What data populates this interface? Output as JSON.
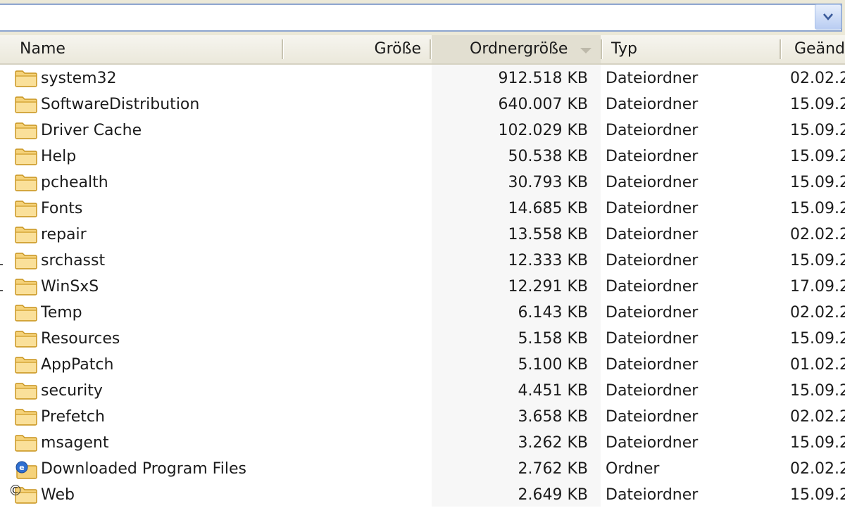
{
  "address_bar": {
    "value": "",
    "dropdown_icon": "chevron-down-icon"
  },
  "columns": {
    "name": "Name",
    "size": "Größe",
    "folder_size": "Ordnergröße",
    "type": "Typ",
    "modified": "Geände"
  },
  "sort": {
    "column": "folder_size",
    "direction": "descending",
    "icon": "sort-arrow-icon"
  },
  "rows": [
    {
      "name": "system32",
      "folder_size": "912.518 KB",
      "type": "Dateiordner",
      "modified": "02.02.2",
      "icon": "folder-icon"
    },
    {
      "name": "SoftwareDistribution",
      "folder_size": "640.007 KB",
      "type": "Dateiordner",
      "modified": "15.09.2",
      "icon": "folder-icon"
    },
    {
      "name": "Driver Cache",
      "folder_size": "102.029 KB",
      "type": "Dateiordner",
      "modified": "15.09.2",
      "icon": "folder-icon"
    },
    {
      "name": "Help",
      "folder_size": "50.538 KB",
      "type": "Dateiordner",
      "modified": "15.09.2",
      "icon": "folder-icon"
    },
    {
      "name": "pchealth",
      "folder_size": "30.793 KB",
      "type": "Dateiordner",
      "modified": "15.09.2",
      "icon": "folder-icon"
    },
    {
      "name": "Fonts",
      "folder_size": "14.685 KB",
      "type": "Dateiordner",
      "modified": "15.09.2",
      "icon": "folder-icon"
    },
    {
      "name": "repair",
      "folder_size": "13.558 KB",
      "type": "Dateiordner",
      "modified": "02.02.2",
      "icon": "folder-icon"
    },
    {
      "name": "srchasst",
      "folder_size": "12.333 KB",
      "type": "Dateiordner",
      "modified": "15.09.2",
      "icon": "folder-icon"
    },
    {
      "name": "WinSxS",
      "folder_size": "12.291 KB",
      "type": "Dateiordner",
      "modified": "17.09.2",
      "icon": "folder-icon"
    },
    {
      "name": "Temp",
      "folder_size": "6.143 KB",
      "type": "Dateiordner",
      "modified": "02.02.2",
      "icon": "folder-icon"
    },
    {
      "name": "Resources",
      "folder_size": "5.158 KB",
      "type": "Dateiordner",
      "modified": "15.09.2",
      "icon": "folder-icon"
    },
    {
      "name": "AppPatch",
      "folder_size": "5.100 KB",
      "type": "Dateiordner",
      "modified": "01.02.2",
      "icon": "folder-icon"
    },
    {
      "name": "security",
      "folder_size": "4.451 KB",
      "type": "Dateiordner",
      "modified": "15.09.2",
      "icon": "folder-icon"
    },
    {
      "name": "Prefetch",
      "folder_size": "3.658 KB",
      "type": "Dateiordner",
      "modified": "02.02.2",
      "icon": "folder-icon"
    },
    {
      "name": "msagent",
      "folder_size": "3.262 KB",
      "type": "Dateiordner",
      "modified": "15.09.2",
      "icon": "folder-icon"
    },
    {
      "name": "Downloaded Program Files",
      "folder_size": "2.762 KB",
      "type": "Ordner",
      "modified": "02.02.2",
      "icon": "ie-folder-icon"
    },
    {
      "name": "Web",
      "folder_size": "2.649 KB",
      "type": "Dateiordner",
      "modified": "15.09.2",
      "icon": "folder-icon"
    }
  ],
  "copyright_mark": "©",
  "colors": {
    "folder_fill": "#f5d27a",
    "folder_stroke": "#c8941f",
    "header_bg": "#ece9d8",
    "address_border": "#8da5cf",
    "sorted_column_bg": "#f7f7f7"
  }
}
